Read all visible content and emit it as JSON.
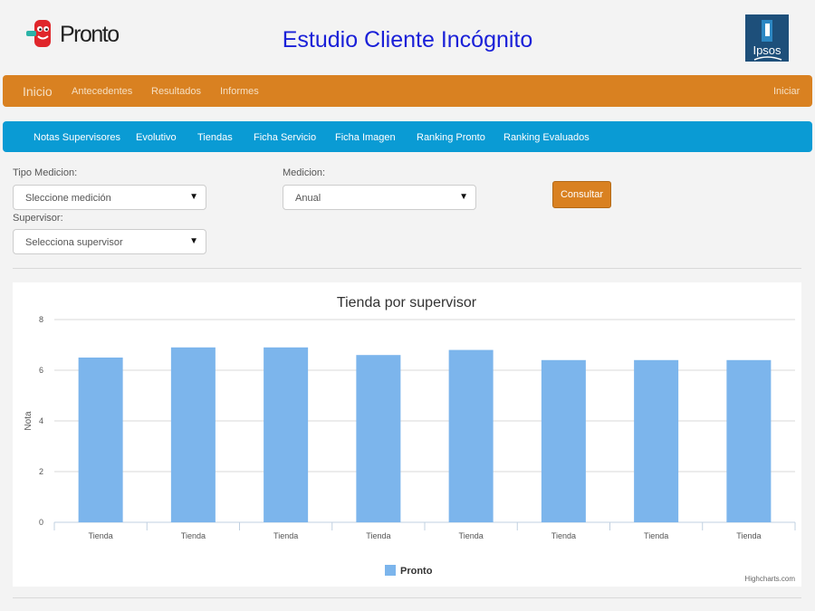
{
  "header": {
    "logo_text": "Pronto",
    "title": "Estudio Cliente Incógnito",
    "ipsos_logo_text": "Ipsos"
  },
  "topnav": {
    "brand": "Inicio",
    "items": [
      "Antecedentes",
      "Resultados",
      "Informes"
    ],
    "login": "Iniciar"
  },
  "subnav": {
    "items": [
      "Notas Supervisores",
      "Evolutivo",
      "Tiendas",
      "Ficha Servicio",
      "Ficha Imagen",
      "Ranking Pronto",
      "Ranking Evaluados"
    ]
  },
  "filters": {
    "tipo_label": "Tipo Medicion:",
    "tipo_value": "Sleccione medición",
    "medicion_label": "Medicion:",
    "medicion_value": "Anual",
    "supervisor_label": "Supervisor:",
    "supervisor_value": "Selecciona supervisor",
    "consultar_label": "Consultar"
  },
  "colors": {
    "orange": "#d98121",
    "blue": "#0a9bd4",
    "bar": "#7cb5ec",
    "title_blue": "#1a20d8"
  },
  "chart_data": {
    "type": "bar",
    "title": "Tienda por supervisor",
    "ylabel": "Nota",
    "xlabel": "",
    "categories": [
      "Tienda",
      "Tienda",
      "Tienda",
      "Tienda",
      "Tienda",
      "Tienda",
      "Tienda",
      "Tienda"
    ],
    "series": [
      {
        "name": "Pronto",
        "values": [
          6.5,
          6.9,
          6.9,
          6.6,
          6.8,
          6.4,
          6.4,
          6.4
        ]
      }
    ],
    "ylim": [
      0,
      8
    ],
    "yticks": [
      0,
      2,
      4,
      6,
      8
    ],
    "grid": true,
    "legend": "bottom-center",
    "credits": "Highcharts.com"
  }
}
